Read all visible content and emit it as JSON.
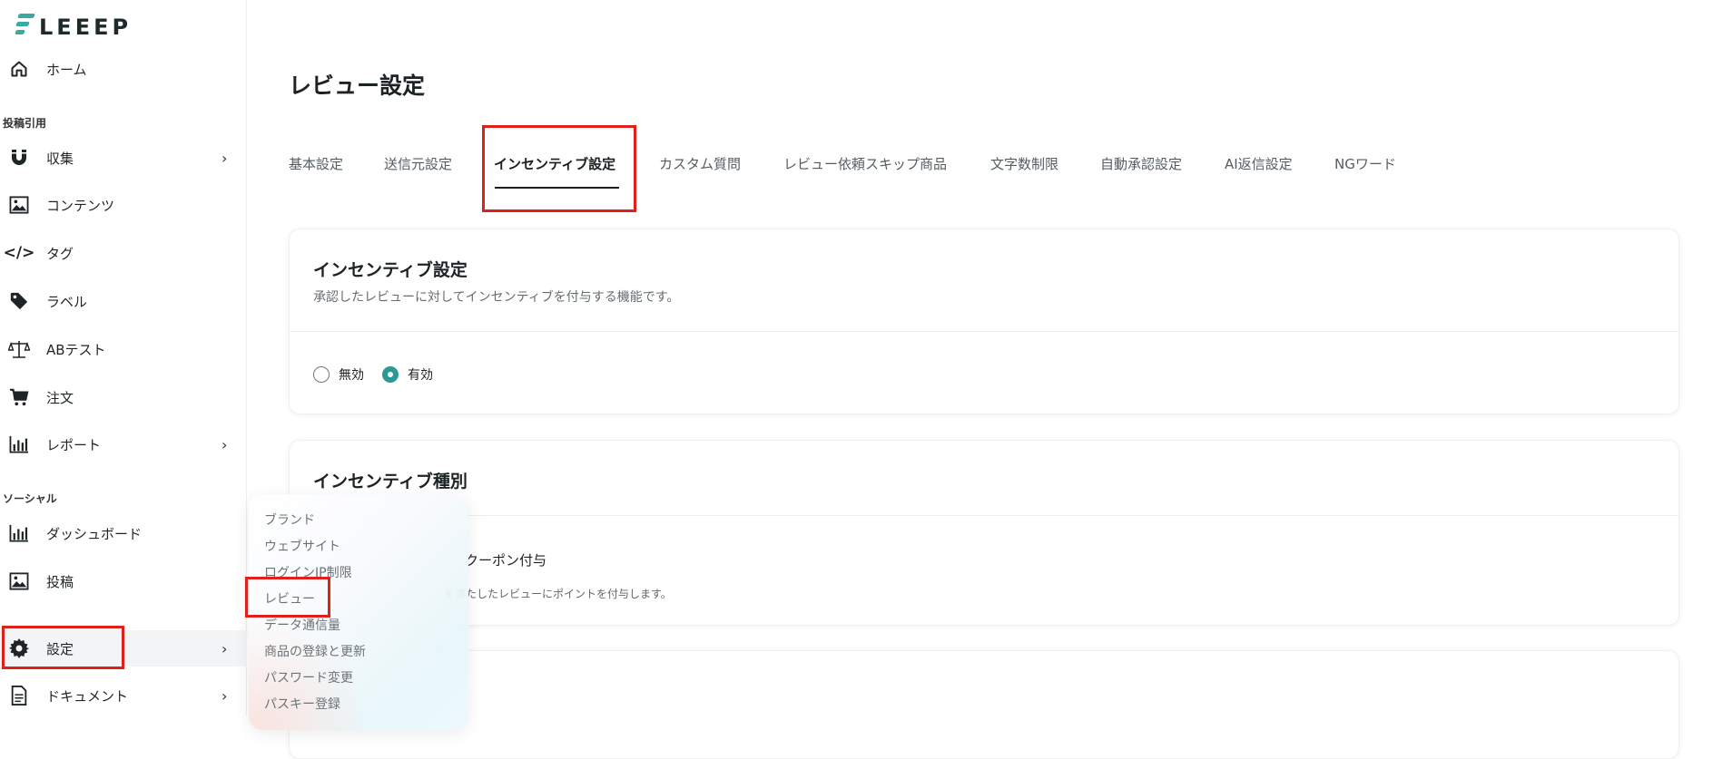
{
  "brand": {
    "logo_text": "LEEEP",
    "accent": "#2b9a94",
    "highlight": "#e0201b"
  },
  "sidebar": {
    "home": "ホーム",
    "section_posting": "投稿引用",
    "collect": "収集",
    "contents": "コンテンツ",
    "tag": "タグ",
    "label": "ラベル",
    "abtest": "ABテスト",
    "order": "注文",
    "report": "レポート",
    "section_social": "ソーシャル",
    "dashboard": "ダッシュボード",
    "post": "投稿",
    "settings": "設定",
    "documents": "ドキュメント"
  },
  "submenu": {
    "items": [
      "ブランド",
      "ウェブサイト",
      "ログインIP制限",
      "レビュー",
      "データ通信量",
      "商品の登録と更新",
      "パスワード変更",
      "パスキー登録"
    ]
  },
  "main": {
    "title": "レビュー設定",
    "tabs": [
      "基本設定",
      "送信元設定",
      "インセンティブ設定",
      "カスタム質問",
      "レビュー依頼スキップ商品",
      "文字数制限",
      "自動承認設定",
      "AI返信設定",
      "NGワード"
    ],
    "active_tab": "インセンティブ設定",
    "incentive_card": {
      "title": "インセンティブ設定",
      "description": "承認したレビューに対してインセンティブを付与する機能です。",
      "radio_off": "無効",
      "radio_on": "有効",
      "selected": "有効"
    },
    "type_card": {
      "title": "インセンティブ種別",
      "option_title": "クーポン付与",
      "option_desc": "を満たしたレビューにポイントを付与します。"
    }
  }
}
